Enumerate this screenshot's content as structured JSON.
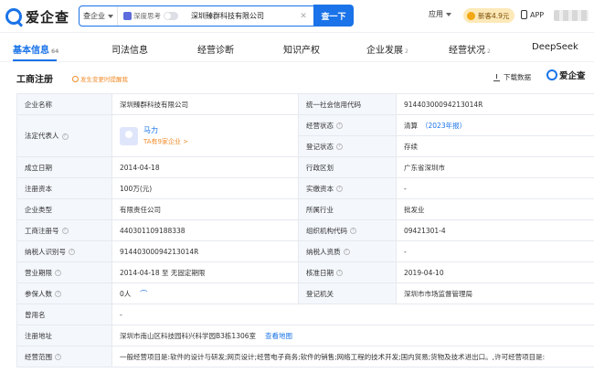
{
  "header": {
    "logo_text": "爱企查",
    "search_scope": "查企业",
    "deep_think_label": "深度思考",
    "search_value": "深圳臻群科技有限公司",
    "search_button": "查一下",
    "apps_label": "应用",
    "promo_label": "新客4.9元",
    "app_label": "APP"
  },
  "tabs": [
    {
      "label": "基本信息",
      "count": "64"
    },
    {
      "label": "司法信息",
      "count": ""
    },
    {
      "label": "经营诊断",
      "count": ""
    },
    {
      "label": "知识产权",
      "count": ""
    },
    {
      "label": "企业发展",
      "count": "2"
    },
    {
      "label": "经营状况",
      "count": "2"
    },
    {
      "label": "DeepSeek",
      "count": ""
    }
  ],
  "section": {
    "title": "工商注册",
    "badge": "发生变更时提醒我",
    "download_label": "下载数据",
    "brand_label": "爱企查"
  },
  "table": {
    "company_name_label": "企业名称",
    "company_name": "深圳臻群科技有限公司",
    "credit_code_label": "统一社会信用代码",
    "credit_code": "91440300094213014R",
    "legal_rep_label": "法定代表人",
    "legal_rep_name": "马力",
    "legal_rep_sub": "TA有9家企业 >",
    "biz_status_label": "经营状态",
    "biz_status": "清算",
    "biz_status_year": "（2023年报）",
    "reg_status_label": "登记状态",
    "reg_status": "存续",
    "est_date_label": "成立日期",
    "est_date": "2014-04-18",
    "region_label": "行政区划",
    "region": "广东省深圳市",
    "reg_capital_label": "注册资本",
    "reg_capital": "100万(元)",
    "paid_capital_label": "实缴资本",
    "paid_capital": "-",
    "company_type_label": "企业类型",
    "company_type": "有限责任公司",
    "industry_label": "所属行业",
    "industry": "批发业",
    "reg_no_label": "工商注册号",
    "reg_no": "440301109188338",
    "org_code_label": "组织机构代码",
    "org_code": "09421301-4",
    "taxpayer_id_label": "纳税人识别号",
    "taxpayer_id": "91440300094213014R",
    "taxpayer_qual_label": "纳税人资质",
    "taxpayer_qual": "-",
    "term_label": "营业期限",
    "term": "2014-04-18 至 无固定期限",
    "approve_date_label": "核准日期",
    "approve_date": "2019-04-10",
    "insured_label": "参保人数",
    "insured": "0人",
    "reg_authority_label": "登记机关",
    "reg_authority": "深圳市市场监督管理局",
    "former_name_label": "曾用名",
    "former_name": "-",
    "address_label": "注册地址",
    "address": "深圳市南山区科技园科兴科学园B3栋1306室",
    "address_link": "查看地图",
    "scope_label": "经营范围",
    "scope": "一般经营项目是:软件的设计与研发;网页设计;经营电子商务;软件的销售;网络工程的技术开发;国内贸易;货物及技术进出口。,许可经营项目是:"
  }
}
